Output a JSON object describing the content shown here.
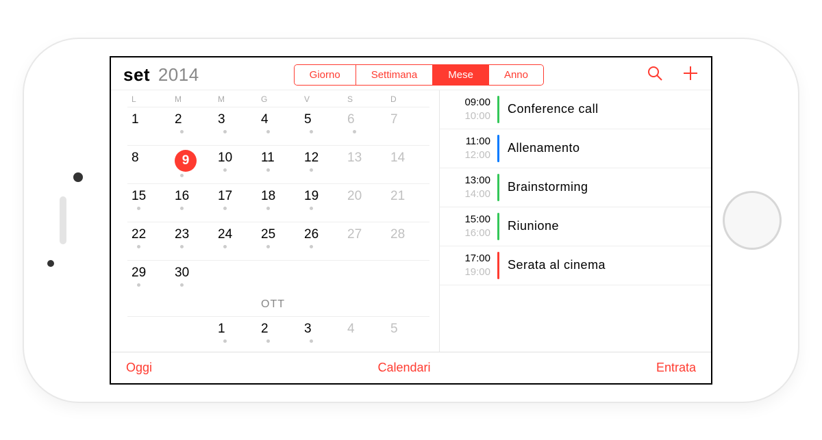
{
  "colors": {
    "accent": "#ff3b30",
    "green": "#34c759",
    "blue": "#007aff"
  },
  "header": {
    "title_month": "set",
    "title_year": "2014",
    "segments": [
      {
        "label": "Giorno",
        "active": false
      },
      {
        "label": "Settimana",
        "active": false
      },
      {
        "label": "Mese",
        "active": true
      },
      {
        "label": "Anno",
        "active": false
      }
    ]
  },
  "dow": [
    "L",
    "M",
    "M",
    "G",
    "V",
    "S",
    "D"
  ],
  "month_rows": [
    [
      {
        "n": "1",
        "dot": false,
        "muted": false
      },
      {
        "n": "2",
        "dot": true,
        "muted": false
      },
      {
        "n": "3",
        "dot": true,
        "muted": false
      },
      {
        "n": "4",
        "dot": true,
        "muted": false
      },
      {
        "n": "5",
        "dot": true,
        "muted": false
      },
      {
        "n": "6",
        "dot": true,
        "muted": true
      },
      {
        "n": "7",
        "dot": false,
        "muted": true
      }
    ],
    [
      {
        "n": "8",
        "dot": false,
        "muted": false
      },
      {
        "n": "9",
        "dot": true,
        "muted": false,
        "selected": true
      },
      {
        "n": "10",
        "dot": true,
        "muted": false
      },
      {
        "n": "11",
        "dot": true,
        "muted": false
      },
      {
        "n": "12",
        "dot": true,
        "muted": false
      },
      {
        "n": "13",
        "dot": false,
        "muted": true
      },
      {
        "n": "14",
        "dot": false,
        "muted": true
      }
    ],
    [
      {
        "n": "15",
        "dot": true,
        "muted": false
      },
      {
        "n": "16",
        "dot": true,
        "muted": false
      },
      {
        "n": "17",
        "dot": true,
        "muted": false
      },
      {
        "n": "18",
        "dot": true,
        "muted": false
      },
      {
        "n": "19",
        "dot": true,
        "muted": false
      },
      {
        "n": "20",
        "dot": false,
        "muted": true
      },
      {
        "n": "21",
        "dot": false,
        "muted": true
      }
    ],
    [
      {
        "n": "22",
        "dot": true,
        "muted": false
      },
      {
        "n": "23",
        "dot": true,
        "muted": false
      },
      {
        "n": "24",
        "dot": true,
        "muted": false
      },
      {
        "n": "25",
        "dot": true,
        "muted": false
      },
      {
        "n": "26",
        "dot": true,
        "muted": false
      },
      {
        "n": "27",
        "dot": false,
        "muted": true
      },
      {
        "n": "28",
        "dot": false,
        "muted": true
      }
    ],
    [
      {
        "n": "29",
        "dot": true,
        "muted": false
      },
      {
        "n": "30",
        "dot": true,
        "muted": false
      },
      {
        "n": "",
        "dot": false,
        "muted": false
      },
      {
        "n": "",
        "dot": false,
        "muted": false
      },
      {
        "n": "",
        "dot": false,
        "muted": false
      },
      {
        "n": "",
        "dot": false,
        "muted": false
      },
      {
        "n": "",
        "dot": false,
        "muted": false
      }
    ]
  ],
  "next_month_label": "OTT",
  "next_month_row": [
    {
      "n": "",
      "dot": false,
      "muted": false
    },
    {
      "n": "",
      "dot": false,
      "muted": false
    },
    {
      "n": "1",
      "dot": true,
      "muted": false
    },
    {
      "n": "2",
      "dot": true,
      "muted": false
    },
    {
      "n": "3",
      "dot": true,
      "muted": false
    },
    {
      "n": "4",
      "dot": false,
      "muted": true
    },
    {
      "n": "5",
      "dot": false,
      "muted": true
    }
  ],
  "events": [
    {
      "start": "09:00",
      "end": "10:00",
      "title": "Conference call",
      "color": "#34c759"
    },
    {
      "start": "11:00",
      "end": "12:00",
      "title": "Allenamento",
      "color": "#007aff"
    },
    {
      "start": "13:00",
      "end": "14:00",
      "title": "Brainstorming",
      "color": "#34c759"
    },
    {
      "start": "15:00",
      "end": "16:00",
      "title": "Riunione",
      "color": "#34c759"
    },
    {
      "start": "17:00",
      "end": "19:00",
      "title": "Serata al cinema",
      "color": "#ff3b30"
    }
  ],
  "footer": {
    "today": "Oggi",
    "calendars": "Calendari",
    "inbox": "Entrata"
  }
}
